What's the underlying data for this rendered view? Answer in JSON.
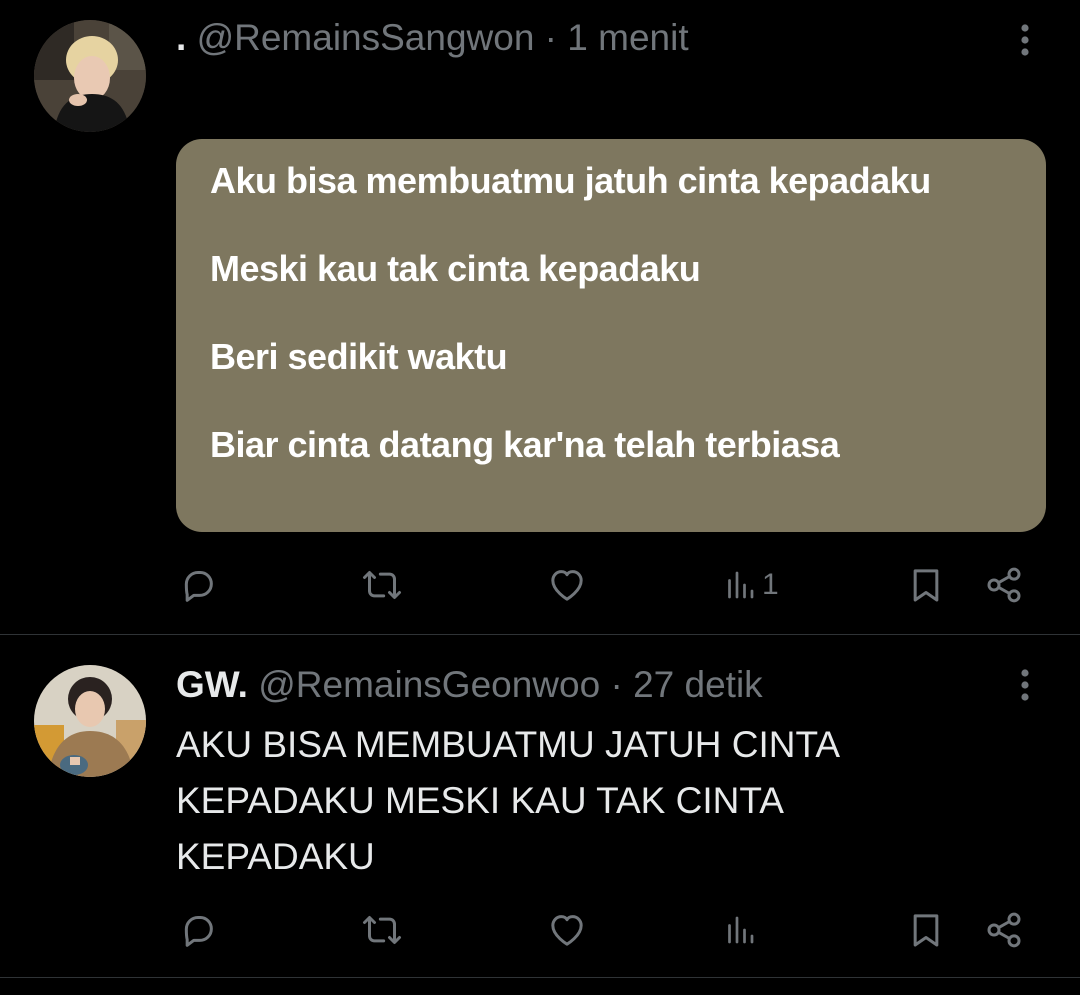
{
  "posts": [
    {
      "display_name": ".",
      "handle": "@RemainsSangwon",
      "separator": " · ",
      "time": "1 menit",
      "quote_lines": [
        "Aku bisa membuatmu jatuh cinta kepadaku",
        "Meski kau tak cinta kepadaku",
        "Beri sedikit waktu",
        "Biar cinta datang kar'na telah terbiasa"
      ],
      "quote_bg": "#7e775f",
      "views": "1"
    },
    {
      "display_name": "GW.",
      "handle": "@RemainsGeonwoo",
      "separator": " · ",
      "time": "27 detik",
      "text": "AKU BISA MEMBUATMU JATUH CINTA\nKEPADAKU MESKI KAU TAK CINTA\nKEPADAKU",
      "views": ""
    }
  ],
  "icons": [
    "reply-icon",
    "repost-icon",
    "like-icon",
    "views-icon",
    "bookmark-icon",
    "share-icon",
    "more-icon"
  ],
  "colors": {
    "background": "#000000",
    "text": "#e7e9ea",
    "muted": "#71767b",
    "divider": "#2f3336"
  }
}
